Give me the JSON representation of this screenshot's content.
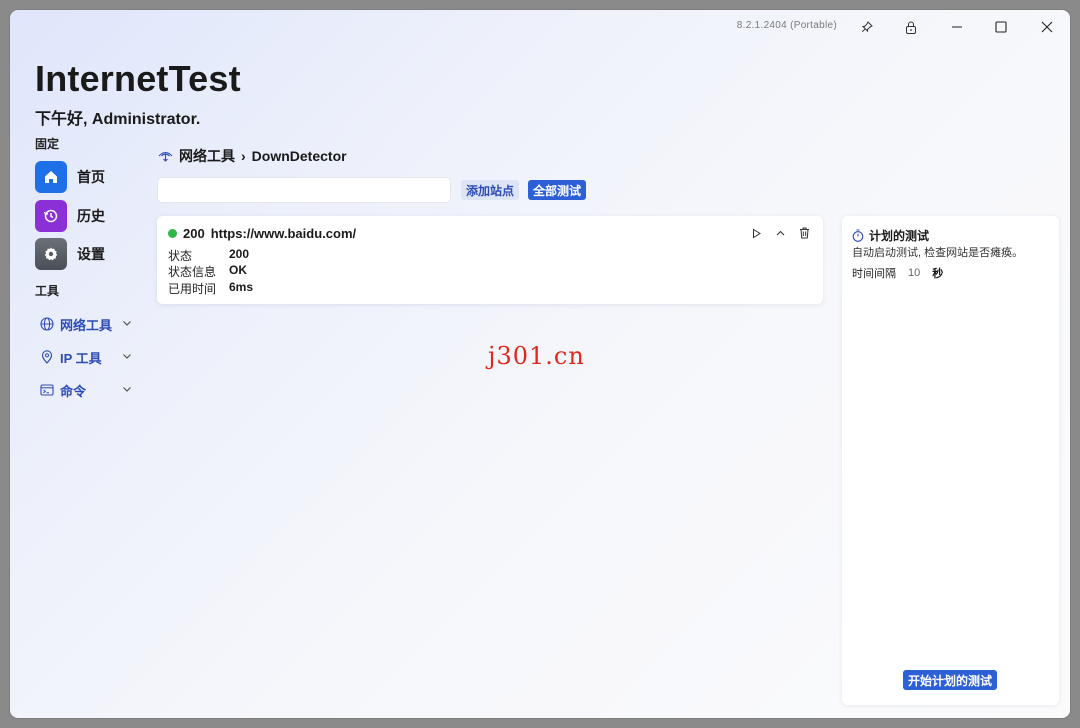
{
  "window": {
    "version": "8.2.1.2404 (Portable)"
  },
  "app": {
    "title": "InternetTest",
    "greeting": "下午好, Administrator."
  },
  "nav": {
    "pinned_label": "固定",
    "pinned": [
      {
        "label": "首页",
        "icon": "home-icon",
        "color": "#1f6fe8"
      },
      {
        "label": "历史",
        "icon": "history-icon",
        "color": "#8b2fd6"
      },
      {
        "label": "设置",
        "icon": "gear-icon",
        "color": "#5b5f68"
      }
    ],
    "tools_label": "工具",
    "tools": [
      {
        "label": "网络工具",
        "icon": "globe-icon"
      },
      {
        "label": "IP 工具",
        "icon": "location-pin-icon"
      },
      {
        "label": "命令",
        "icon": "terminal-icon"
      }
    ]
  },
  "breadcrumb": {
    "parent": "网络工具",
    "separator": "›",
    "current": "DownDetector"
  },
  "toolbar": {
    "url_value": "",
    "add_label": "添加站点",
    "test_all_label": "全部测试"
  },
  "sites": [
    {
      "status_code": "200",
      "url": "https://www.baidu.com/",
      "status_color": "#2fb84a",
      "fields": [
        {
          "key": "状态",
          "value": "200"
        },
        {
          "key": "状态信息",
          "value": "OK"
        },
        {
          "key": "已用时间",
          "value": "6ms"
        }
      ]
    }
  ],
  "watermark": "j301.cn",
  "scheduled": {
    "title": "计划的测试",
    "description": "自动启动测试, 检查网站是否瘫痪。",
    "interval_label": "时间间隔",
    "interval_value": "10",
    "interval_unit": "秒",
    "start_label": "开始计划的测试"
  },
  "colors": {
    "accent": "#2d5fd6",
    "link": "#2d4bb4"
  }
}
